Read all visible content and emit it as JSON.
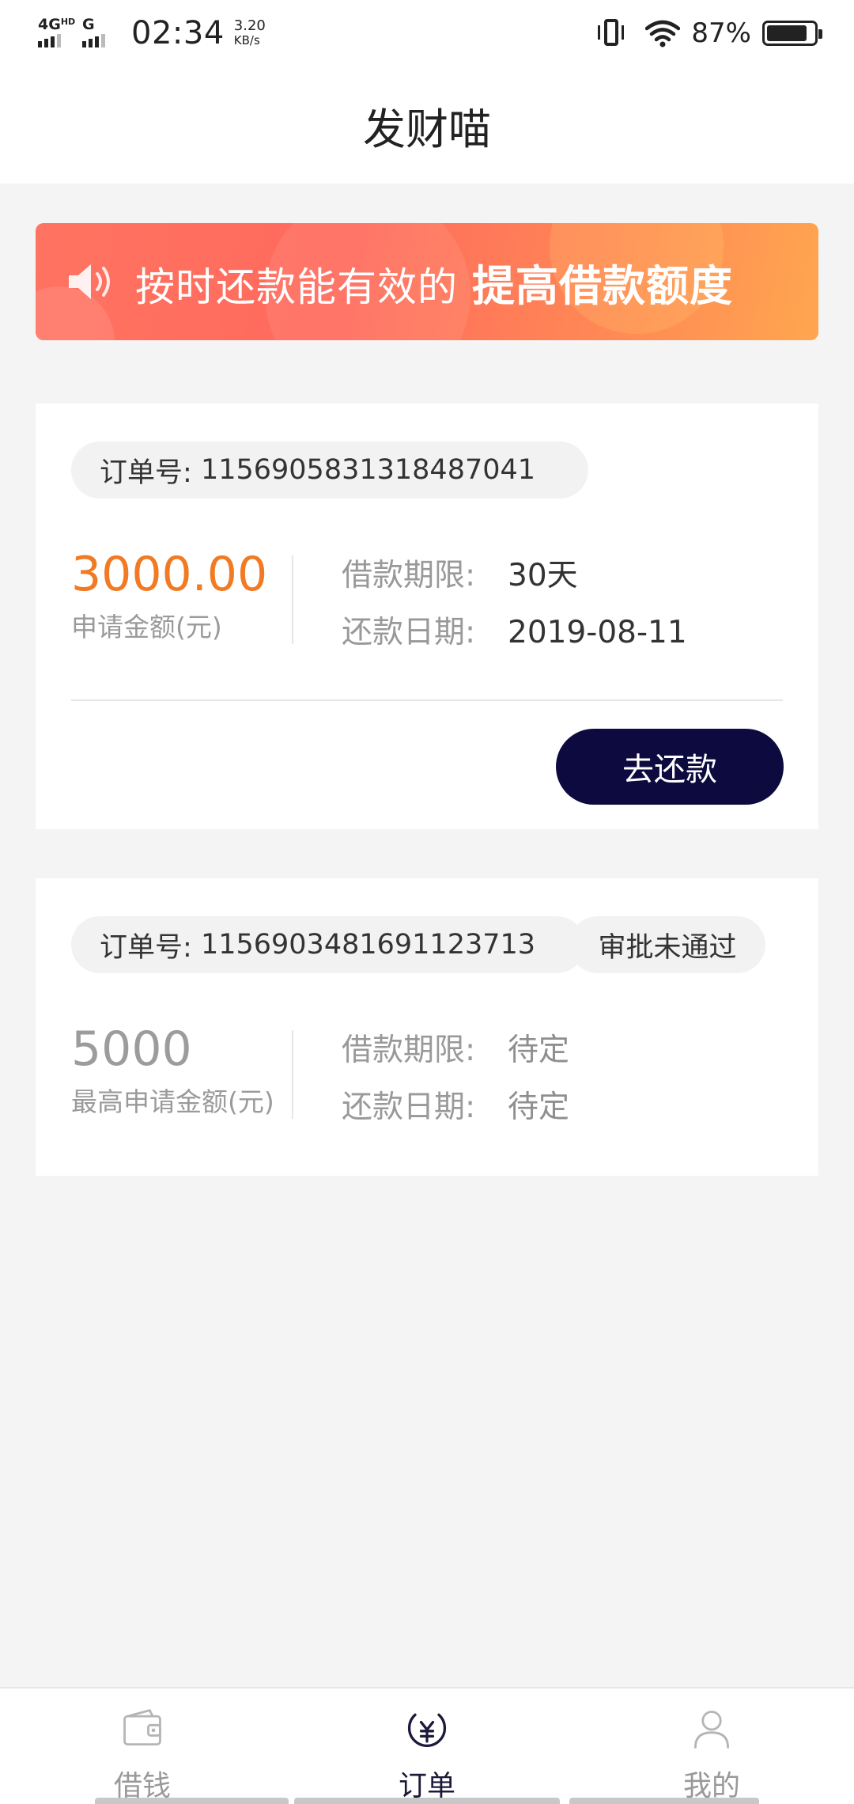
{
  "status_bar": {
    "network1": "4G",
    "network1_sup": "HD",
    "network2": "G",
    "time": "02:34",
    "speed_value": "3.20",
    "speed_unit": "KB/s",
    "battery_percent": "87%"
  },
  "header": {
    "title": "发财喵"
  },
  "banner": {
    "text": "按时还款能有效的",
    "highlight": "提高借款额度"
  },
  "orders": [
    {
      "order_label": "订单号:",
      "order_no": "1156905831318487041",
      "amount": "3000.00",
      "amount_label": "申请金额(元)",
      "term_label": "借款期限:",
      "term_value": "30天",
      "date_label": "还款日期:",
      "date_value": "2019-08-11",
      "action_label": "去还款"
    },
    {
      "order_label": "订单号:",
      "order_no": "1156903481691123713",
      "status": "审批未通过",
      "amount": "5000",
      "amount_label": "最高申请金额(元)",
      "term_label": "借款期限:",
      "term_value": "待定",
      "date_label": "还款日期:",
      "date_value": "待定"
    }
  ],
  "bottom_nav": [
    {
      "label": "借钱",
      "icon": "wallet-icon",
      "active": false
    },
    {
      "label": "订单",
      "icon": "yen-coin-icon",
      "active": true
    },
    {
      "label": "我的",
      "icon": "user-icon",
      "active": false
    }
  ],
  "colors": {
    "accent_amount": "#f17a23",
    "primary_button": "#0d0a3f",
    "banner_start": "#ff7361",
    "banner_end": "#ffa64f"
  }
}
